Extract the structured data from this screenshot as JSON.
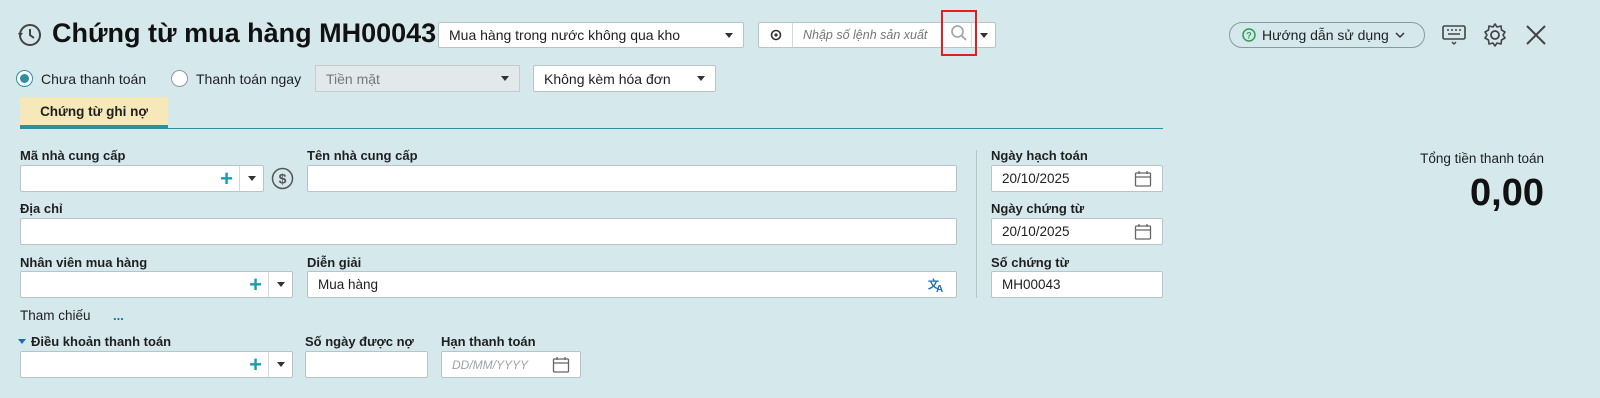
{
  "header": {
    "title": "Chứng từ mua hàng MH00043",
    "type_select": "Mua hàng trong nước không qua kho",
    "production_placeholder": "Nhập số lệnh sản xuất",
    "help_label": "Hướng dẫn sử dụng"
  },
  "payment": {
    "unpaid_label": "Chưa thanh toán",
    "paid_now_label": "Thanh toán ngay",
    "method_select": "Tiền mặt",
    "invoice_select": "Không kèm hóa đơn"
  },
  "tabs": [
    {
      "label": "Chứng từ ghi nợ"
    }
  ],
  "form": {
    "supplier_code_label": "Mã nhà cung cấp",
    "supplier_name_label": "Tên nhà cung cấp",
    "address_label": "Địa chỉ",
    "buyer_label": "Nhân viên mua hàng",
    "description_label": "Diễn giải",
    "description_value": "Mua hàng",
    "reference_label": "Tham chiếu",
    "reference_more": "...",
    "payment_terms_label": "Điều khoản thanh toán",
    "credit_days_label": "Số ngày được nợ",
    "due_date_label": "Hạn thanh toán",
    "due_date_placeholder": "DD/MM/YYYY"
  },
  "right": {
    "posting_date_label": "Ngày hạch toán",
    "posting_date_value": "20/10/2025",
    "voucher_date_label": "Ngày chứng từ",
    "voucher_date_value": "20/10/2025",
    "voucher_no_label": "Số chứng từ",
    "voucher_no_value": "MH00043"
  },
  "total": {
    "label": "Tổng tiền thanh toán",
    "value": "0,00"
  },
  "colors": {
    "background": "#d5e8ec",
    "accent": "#2b8fa6",
    "tab_active": "#f6e8b8",
    "highlight_box": "#e02020"
  }
}
